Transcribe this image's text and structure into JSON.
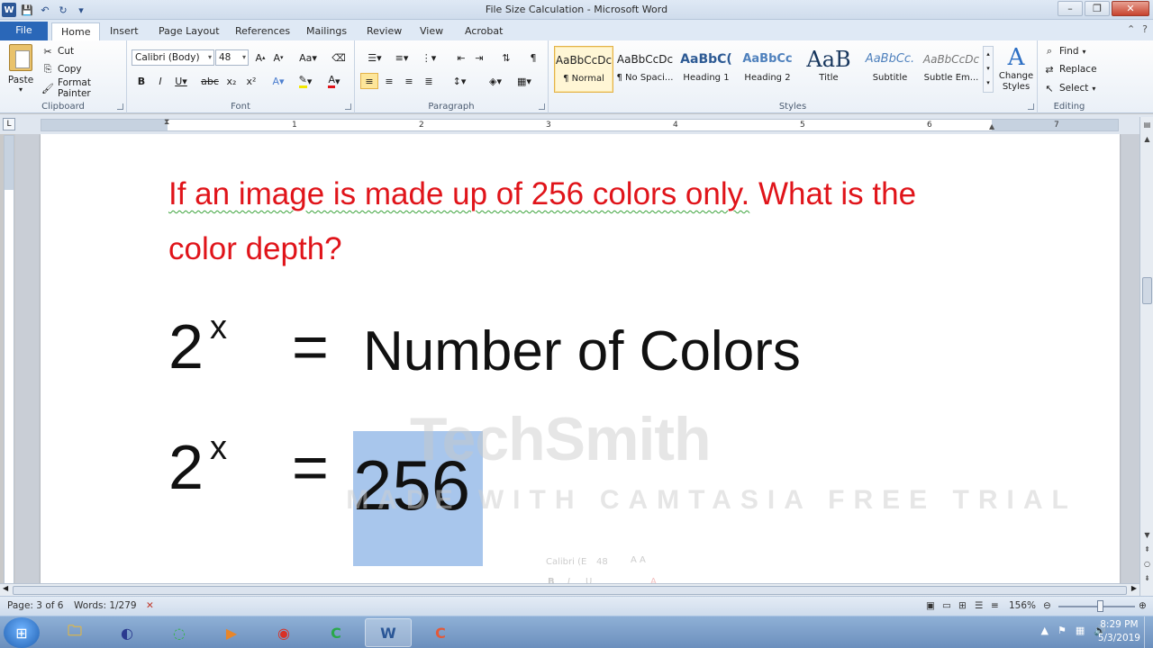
{
  "window": {
    "title": "File Size Calculation  -  Microsoft Word",
    "app_icon": "W",
    "minimize": "–",
    "restore": "❐",
    "close": "✕"
  },
  "tabs": {
    "file": "File",
    "home": "Home",
    "insert": "Insert",
    "page_layout": "Page Layout",
    "references": "References",
    "mailings": "Mailings",
    "review": "Review",
    "view": "View",
    "acrobat": "Acrobat"
  },
  "ribbon": {
    "clipboard": {
      "label": "Clipboard",
      "paste": "Paste",
      "cut": "Cut",
      "copy": "Copy",
      "format_painter": "Format Painter"
    },
    "font": {
      "label": "Font",
      "font_name": "Calibri (Body)",
      "font_size": "48"
    },
    "paragraph": {
      "label": "Paragraph"
    },
    "styles": {
      "label": "Styles",
      "items": [
        {
          "sample": "AaBbCcDc",
          "name": "¶ Normal"
        },
        {
          "sample": "AaBbCcDc",
          "name": "¶ No Spaci..."
        },
        {
          "sample": "AaBbC(",
          "name": "Heading 1"
        },
        {
          "sample": "AaBbCc",
          "name": "Heading 2"
        },
        {
          "sample": "AaB",
          "name": "Title"
        },
        {
          "sample": "AaBbCc.",
          "name": "Subtitle"
        },
        {
          "sample": "AaBbCcDc",
          "name": "Subtle Em..."
        }
      ],
      "change_styles": "Change Styles"
    },
    "editing": {
      "label": "Editing",
      "find": "Find",
      "replace": "Replace",
      "select": "Select"
    }
  },
  "ruler": {
    "numbers": [
      "1",
      "2",
      "3",
      "4",
      "5",
      "6",
      "7"
    ]
  },
  "document": {
    "question_part1": "If an image is made up of 256 colors only.",
    "question_part2": " What is the color depth?",
    "eq1": {
      "base": "2",
      "exp": "x",
      "op": "=",
      "rhs": "Number of Colors"
    },
    "eq2": {
      "base": "2",
      "exp": "x",
      "op": "=",
      "rhs": "256"
    },
    "mini_toolbar_font": "Calibri (E",
    "mini_toolbar_size": "48"
  },
  "watermark": {
    "logo": "TechSmith",
    "sub": "MADE WITH CAMTASIA FREE TRIAL"
  },
  "statusbar": {
    "page": "Page: 3 of 6",
    "words": "Words: 1/279",
    "zoom": "156%"
  },
  "taskbar": {
    "time": "8:29 PM",
    "date": "5/3/2019"
  }
}
